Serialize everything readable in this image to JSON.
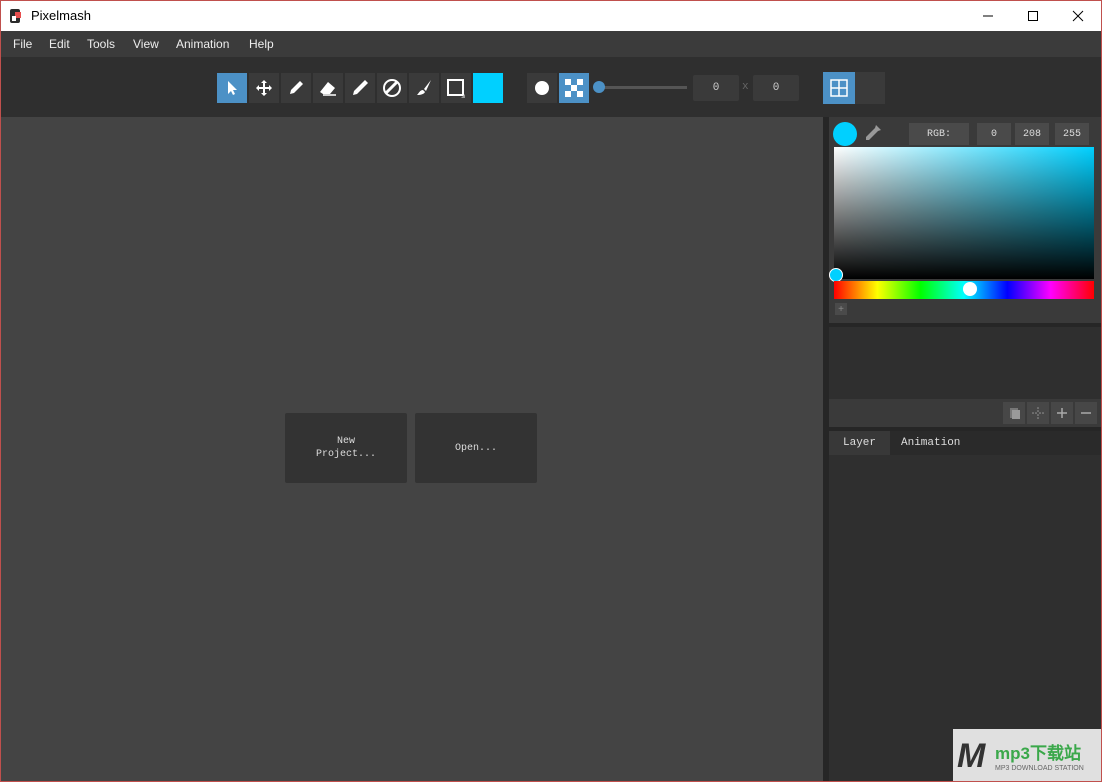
{
  "window": {
    "title": "Pixelmash"
  },
  "menubar": {
    "items": [
      "File",
      "Edit",
      "Tools",
      "View",
      "Animation",
      "Help"
    ]
  },
  "toolbar": {
    "tools": [
      "select-arrow-icon",
      "move-icon",
      "pencil-icon",
      "eraser-icon",
      "brush-icon",
      "fill-icon",
      "paintbrush-icon",
      "rectangle-icon"
    ],
    "active_color": "#00d0ff",
    "accent": "#4c91c6",
    "brush_size_slider": 0,
    "width_value": "0",
    "times_sign": "x",
    "height_value": "0"
  },
  "canvas": {
    "new_project_label": "New\nProject...",
    "open_label": "Open..."
  },
  "color_picker": {
    "swatch_color": "#00d0ff",
    "mode_label": "RGB:",
    "r": "0",
    "g": "208",
    "b": "255",
    "add_symbol": "+"
  },
  "layers": {
    "tabs": [
      "Layer",
      "Animation"
    ]
  },
  "watermark": {
    "brand": "mp3下载站",
    "letter": "M",
    "subtitle": "MP3 DOWNLOAD STATION"
  }
}
